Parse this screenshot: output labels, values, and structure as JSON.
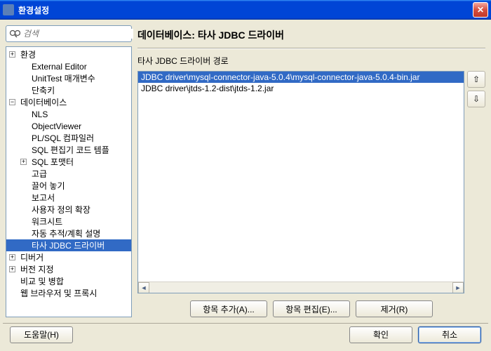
{
  "window": {
    "title": "환경설정"
  },
  "search": {
    "placeholder": "검색"
  },
  "tree": {
    "items": [
      {
        "label": "환경",
        "level": 0,
        "expand": "+"
      },
      {
        "label": "External Editor",
        "level": 1
      },
      {
        "label": "UnitTest 매개변수",
        "level": 1
      },
      {
        "label": "단축키",
        "level": 1
      },
      {
        "label": "데이터베이스",
        "level": 0,
        "expand": "-"
      },
      {
        "label": "NLS",
        "level": 1
      },
      {
        "label": "ObjectViewer",
        "level": 1
      },
      {
        "label": "PL/SQL 컴파일러",
        "level": 1
      },
      {
        "label": "SQL 편집기 코드 템플",
        "level": 1
      },
      {
        "label": "SQL 포맷터",
        "level": 1,
        "expand": "+"
      },
      {
        "label": "고급",
        "level": 1
      },
      {
        "label": "끌어 놓기",
        "level": 1
      },
      {
        "label": "보고서",
        "level": 1
      },
      {
        "label": "사용자 정의 확장",
        "level": 1
      },
      {
        "label": "워크시트",
        "level": 1
      },
      {
        "label": "자동 추적/계획 설명",
        "level": 1
      },
      {
        "label": "타사 JDBC 드라이버",
        "level": 1,
        "selected": true
      },
      {
        "label": "디버거",
        "level": 0,
        "expand": "+"
      },
      {
        "label": "버전 지정",
        "level": 0,
        "expand": "+"
      },
      {
        "label": "비교 및 병합",
        "level": 0
      },
      {
        "label": "웹 브라우저 및 프록시",
        "level": 0
      }
    ]
  },
  "panel": {
    "title": "데이터베이스: 타사 JDBC 드라이버",
    "sublabel": "타사 JDBC 드라이버 경로"
  },
  "list": {
    "items": [
      {
        "text": "JDBC driver\\mysql-connector-java-5.0.4\\mysql-connector-java-5.0.4-bin.jar",
        "selected": true
      },
      {
        "text": "JDBC driver\\jtds-1.2-dist\\jtds-1.2.jar",
        "selected": false
      }
    ]
  },
  "sidebtn": {
    "up": "⇧",
    "down": "⇩"
  },
  "actions": {
    "add": "항목 추가(A)...",
    "edit": "항목 편집(E)...",
    "remove": "제거(R)"
  },
  "footer": {
    "help": "도움말(H)",
    "ok": "확인",
    "cancel": "취소"
  }
}
